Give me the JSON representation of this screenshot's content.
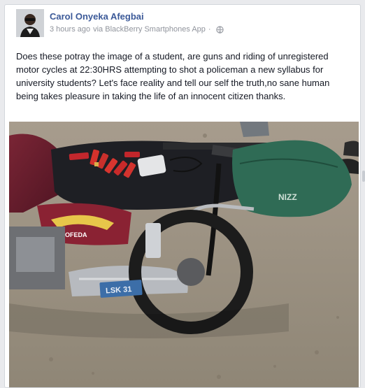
{
  "post": {
    "author": "Carol Onyeka Afegbai",
    "time": "3 hours ago",
    "via": "via BlackBerry Smartphones App",
    "text": "Does these potray the image of a student, are guns and riding of unregistered motor cycles at 22:30HRS attempting to shot a policeman a new syllabus for university students? Let's face reality and tell our self the truth,no sane human being takes pleasure in taking the life of an innocent citizen thanks."
  },
  "icons": {
    "avatar": "profile-avatar",
    "privacy": "globe-icon"
  },
  "photo": {
    "plate_text": "LSK 31",
    "bag_text": "NIZZ",
    "brand_text": "OFEDA"
  },
  "colors": {
    "link": "#3b5998",
    "meta": "#90949c",
    "background": "#e9eaed"
  }
}
